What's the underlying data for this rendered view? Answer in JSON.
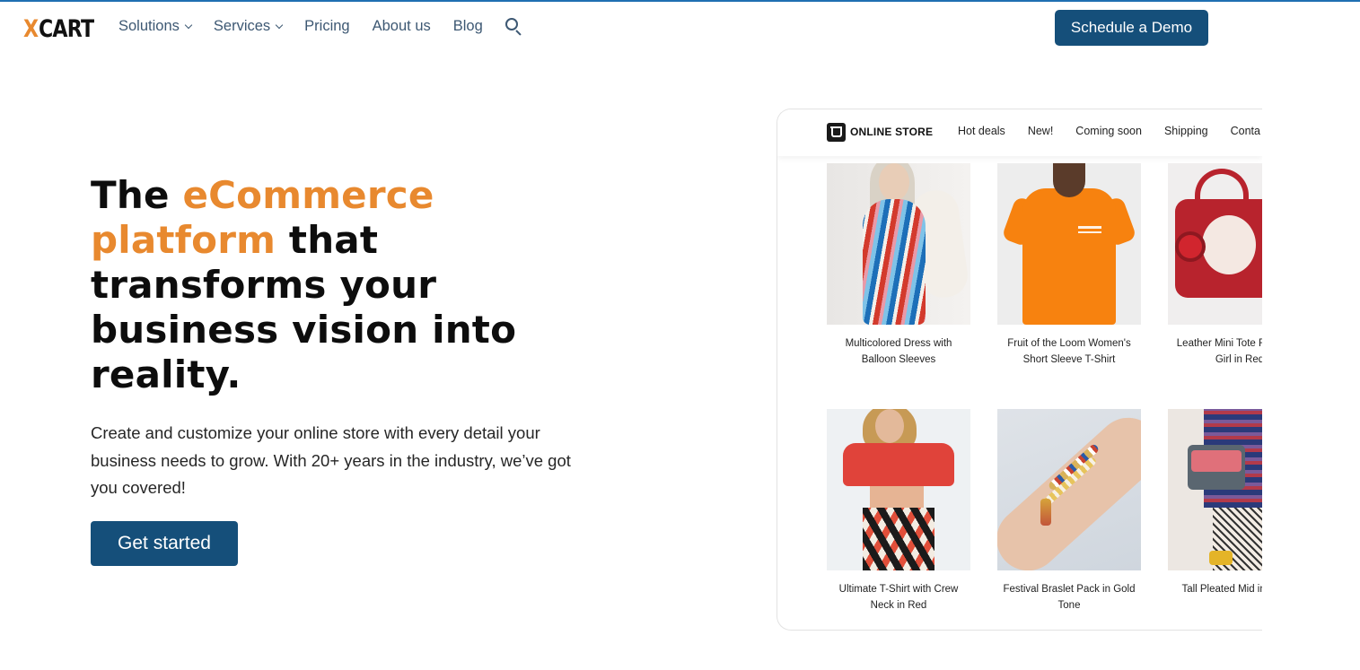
{
  "header": {
    "logo": {
      "x": "X",
      "cart": "CART"
    },
    "nav": [
      {
        "label": "Solutions",
        "has_dropdown": true
      },
      {
        "label": "Services",
        "has_dropdown": true
      },
      {
        "label": "Pricing",
        "has_dropdown": false
      },
      {
        "label": "About us",
        "has_dropdown": false
      },
      {
        "label": "Blog",
        "has_dropdown": false
      }
    ],
    "search_icon": "search-icon",
    "demo_button": "Schedule a Demo"
  },
  "hero": {
    "title_part1": "The ",
    "title_accent": "eCommerce platform",
    "title_part2": " that transforms your business vision into reality.",
    "subtitle": "Create and customize your online store with every detail your business needs to grow. With 20+ years in the industry, we’ve got you covered!",
    "cta": "Get started"
  },
  "store": {
    "name": "ONLINE STORE",
    "nav": [
      "Hot deals",
      "New!",
      "Coming soon",
      "Shipping",
      "Conta"
    ],
    "products": [
      {
        "caption": "Multicolored Dress with Balloon Sleeves"
      },
      {
        "caption": "Fruit of the Loom Women's Short Sleeve T-Shirt"
      },
      {
        "caption": "Leather Mini Tote Rose and Girl in Red"
      },
      {
        "caption": "Ultimate T-Shirt with Crew Neck in Red"
      },
      {
        "caption": "Festival Braslet Pack in Gold Tone"
      },
      {
        "caption": "Tall Pleated Mid in Check"
      }
    ]
  },
  "colors": {
    "brand_orange": "#e8892f",
    "brand_navy": "#154f7a",
    "nav_text": "#3d5873"
  }
}
